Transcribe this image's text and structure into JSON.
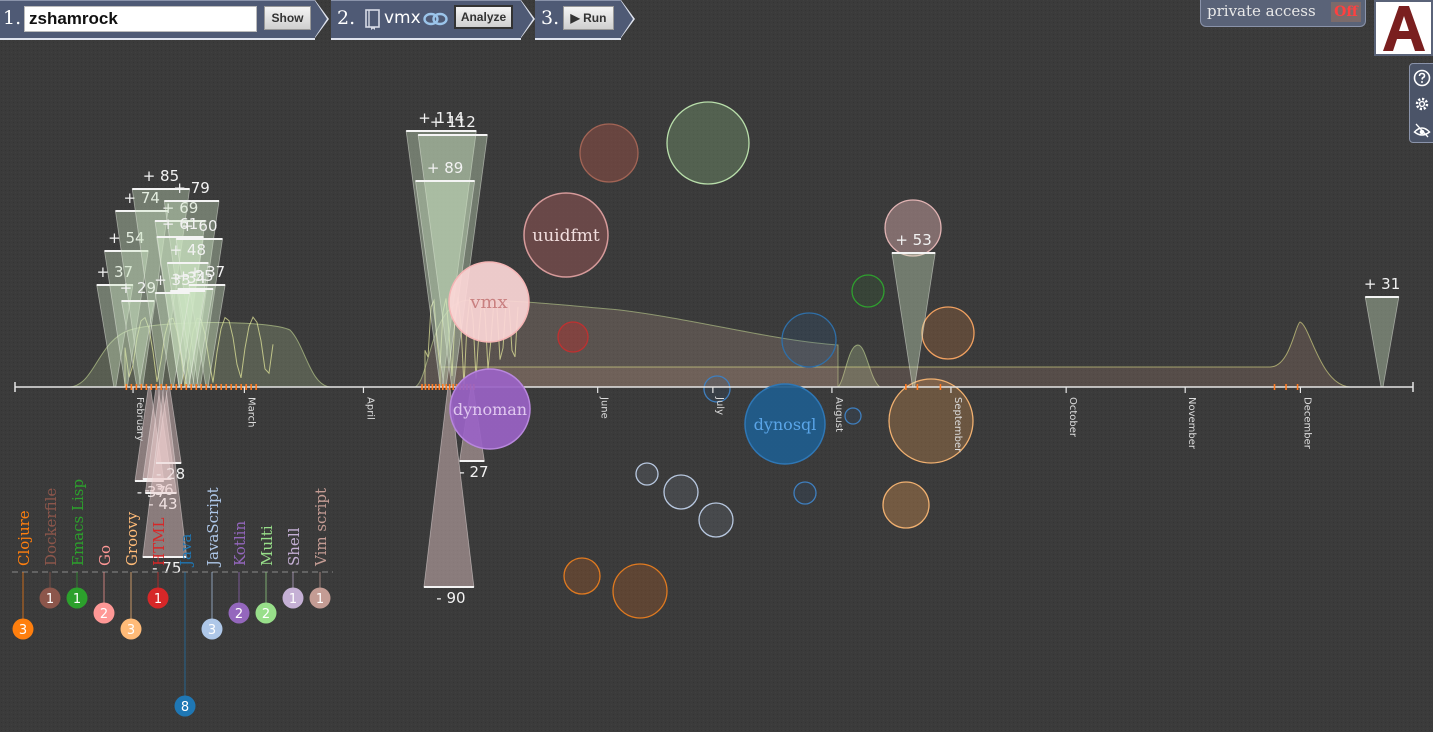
{
  "steps": {
    "step1": {
      "num": "1.",
      "value": "zshamrock",
      "show_label": "Show"
    },
    "step2": {
      "num": "2.",
      "repo": "vmx",
      "analyze_label": "Analyze"
    },
    "step3": {
      "num": "3.",
      "run_label": "▶ Run"
    }
  },
  "private_access": {
    "label": "private access",
    "state": "Off"
  },
  "logo": {
    "letter": "A"
  },
  "tools": [
    {
      "icon": "help-icon"
    },
    {
      "icon": "settings-icon"
    },
    {
      "icon": "view-toggle-icon"
    }
  ],
  "months": [
    "February",
    "March",
    "April",
    "June",
    "July",
    "August",
    "September",
    "October",
    "November",
    "December"
  ],
  "colors": {
    "commit_shade": "#cfe8c8",
    "delete_shade": "#f0d6d6",
    "axis": "#e6e6e6",
    "tick": "#ff7b22",
    "curve": "#e8f0a0"
  },
  "additions": [
    {
      "label": "+ 37",
      "day": 26
    },
    {
      "label": "+ 54",
      "day": 29
    },
    {
      "label": "+ 74",
      "day": 33
    },
    {
      "label": "+ 29",
      "day": 32
    },
    {
      "label": "+ 85",
      "day": 38
    },
    {
      "label": "+ 69",
      "day": 43
    },
    {
      "label": "+ 79",
      "day": 46
    },
    {
      "label": "+ 61",
      "day": 43
    },
    {
      "label": "+ 60",
      "day": 48
    },
    {
      "label": "+ 48",
      "day": 45
    },
    {
      "label": "+ 37",
      "day": 50
    },
    {
      "label": "+ 35",
      "day": 47
    },
    {
      "label": "+ 34",
      "day": 45
    },
    {
      "label": "+ 33",
      "day": 41
    },
    {
      "label": "+ 114",
      "day": 111
    },
    {
      "label": "+ 112",
      "day": 114
    },
    {
      "label": "+ 89",
      "day": 112
    },
    {
      "label": "+ 53",
      "day": 234
    },
    {
      "label": "+ 31",
      "day": 356
    }
  ],
  "deletions": [
    {
      "label": "- 37",
      "day": 35
    },
    {
      "label": "- 36",
      "day": 37
    },
    {
      "label": "- 43",
      "day": 38
    },
    {
      "label": "- 28",
      "day": 40
    },
    {
      "label": "- 75",
      "day": 39
    },
    {
      "label": "- 90",
      "day": 113
    },
    {
      "label": "- 27",
      "day": 119
    }
  ],
  "repos": [
    {
      "name": "vmx",
      "fill": "#fcd7d7",
      "stroke": "#f5b5b5",
      "label_color": "#c98080"
    },
    {
      "name": "dynoman",
      "fill": "#9a63c5",
      "stroke": "#b887dd",
      "label_color": "#e0c8f0"
    },
    {
      "name": "uuidfmt",
      "fill": "#7a4d4d",
      "stroke": "#d69a9a",
      "label_color": "#f2dede"
    },
    {
      "name": "dynosql",
      "fill": "#1f5d8e",
      "stroke": "#2f77b5",
      "label_color": "#5aa5e8"
    }
  ],
  "languages": [
    {
      "name": "Clojure",
      "count": "3",
      "color": "#ff7f0e"
    },
    {
      "name": "Dockerfile",
      "count": "1",
      "color": "#8c564b"
    },
    {
      "name": "Emacs Lisp",
      "count": "1",
      "color": "#2ca02c"
    },
    {
      "name": "Go",
      "count": "2",
      "color": "#ff9896"
    },
    {
      "name": "Groovy",
      "count": "3",
      "color": "#ffbb78"
    },
    {
      "name": "HTML",
      "count": "1",
      "color": "#d62728"
    },
    {
      "name": "Java",
      "count": "8",
      "color": "#1f77b4"
    },
    {
      "name": "JavaScript",
      "count": "3",
      "color": "#aec7e8"
    },
    {
      "name": "Kotlin",
      "count": "2",
      "color": "#9467bd"
    },
    {
      "name": "Multi",
      "count": "2",
      "color": "#98df8a"
    },
    {
      "name": "Shell",
      "count": "1",
      "color": "#c5b0d5"
    },
    {
      "name": "Vim script",
      "count": "1",
      "color": "#c49c94"
    }
  ]
}
